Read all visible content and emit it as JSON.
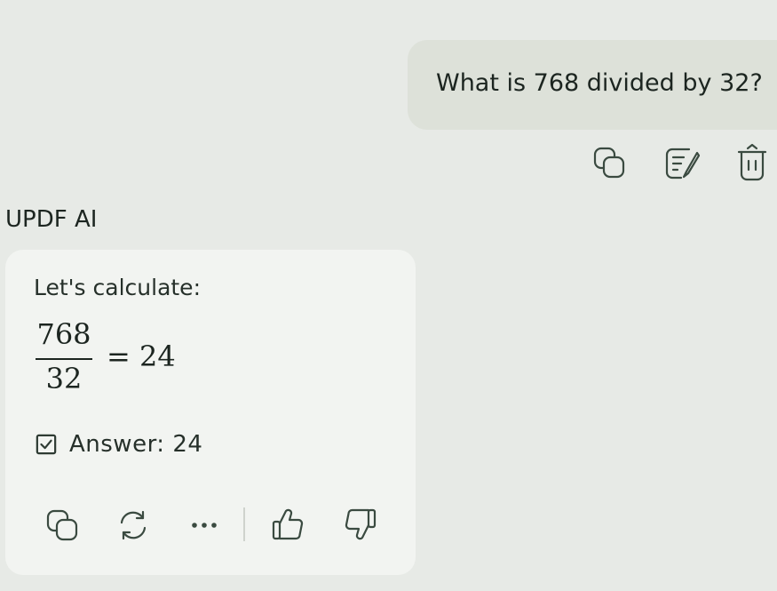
{
  "user_message": {
    "text": "What is 768 divided by 32?",
    "actions": [
      {
        "name": "copy",
        "icon": "copy-icon"
      },
      {
        "name": "edit",
        "icon": "edit-icon"
      },
      {
        "name": "delete",
        "icon": "trash-icon"
      }
    ]
  },
  "assistant": {
    "name": "UPDF AI",
    "intro": "Let's calculate:",
    "math": {
      "numerator": "768",
      "denominator": "32",
      "result": "= 24"
    },
    "answer": "Answer: 24",
    "answer_icon": "check-box-icon",
    "actions": [
      {
        "name": "copy",
        "icon": "copy-icon"
      },
      {
        "name": "regenerate",
        "icon": "refresh-icon"
      },
      {
        "name": "more",
        "icon": "more-icon"
      },
      {
        "name": "like",
        "icon": "thumbs-up-icon"
      },
      {
        "name": "dislike",
        "icon": "thumbs-down-icon"
      }
    ]
  },
  "colors": {
    "background": "#e7eae6",
    "user_bubble": "#dde1d9",
    "assistant_card": "#f2f4f1",
    "text": "#1c2520",
    "icon": "#3a4a40"
  }
}
